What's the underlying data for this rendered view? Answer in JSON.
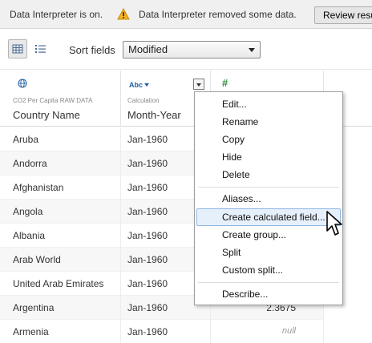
{
  "infobar": {
    "interpreter_on": "Data Interpreter is on.",
    "warning_icon": "warning-icon",
    "removed_msg": "Data Interpreter removed some data.",
    "review_button": "Review results"
  },
  "toolbar": {
    "grid_view_icon": "grid-view-icon",
    "list_view_icon": "list-view-icon",
    "sort_label": "Sort fields",
    "sort_value": "Modified"
  },
  "columns": [
    {
      "type_icon": "globe-icon",
      "source": "CO2 Per Capita RAW DATA",
      "name": "Country Name"
    },
    {
      "type_label": "Abc",
      "source": "Calculation",
      "name": "Month-Year"
    },
    {
      "type_label": "#",
      "source": "",
      "name": ""
    }
  ],
  "rows": [
    {
      "country": "Aruba",
      "month": "Jan-1960",
      "value": ""
    },
    {
      "country": "Andorra",
      "month": "Jan-1960",
      "value": ""
    },
    {
      "country": "Afghanistan",
      "month": "Jan-1960",
      "value": ""
    },
    {
      "country": "Angola",
      "month": "Jan-1960",
      "value": ""
    },
    {
      "country": "Albania",
      "month": "Jan-1960",
      "value": ""
    },
    {
      "country": "Arab World",
      "month": "Jan-1960",
      "value": ""
    },
    {
      "country": "United Arab Emirates",
      "month": "Jan-1960",
      "value": ""
    },
    {
      "country": "Argentina",
      "month": "Jan-1960",
      "value": "2.3675"
    },
    {
      "country": "Armenia",
      "month": "Jan-1960",
      "value": "null"
    }
  ],
  "menu": {
    "items": [
      "Edit...",
      "Rename",
      "Copy",
      "Hide",
      "Delete",
      "Aliases...",
      "Create calculated field...",
      "Create group...",
      "Split",
      "Custom split...",
      "Describe..."
    ],
    "highlighted": "Create calculated field...",
    "highlight_color": "#e6f0fb"
  }
}
